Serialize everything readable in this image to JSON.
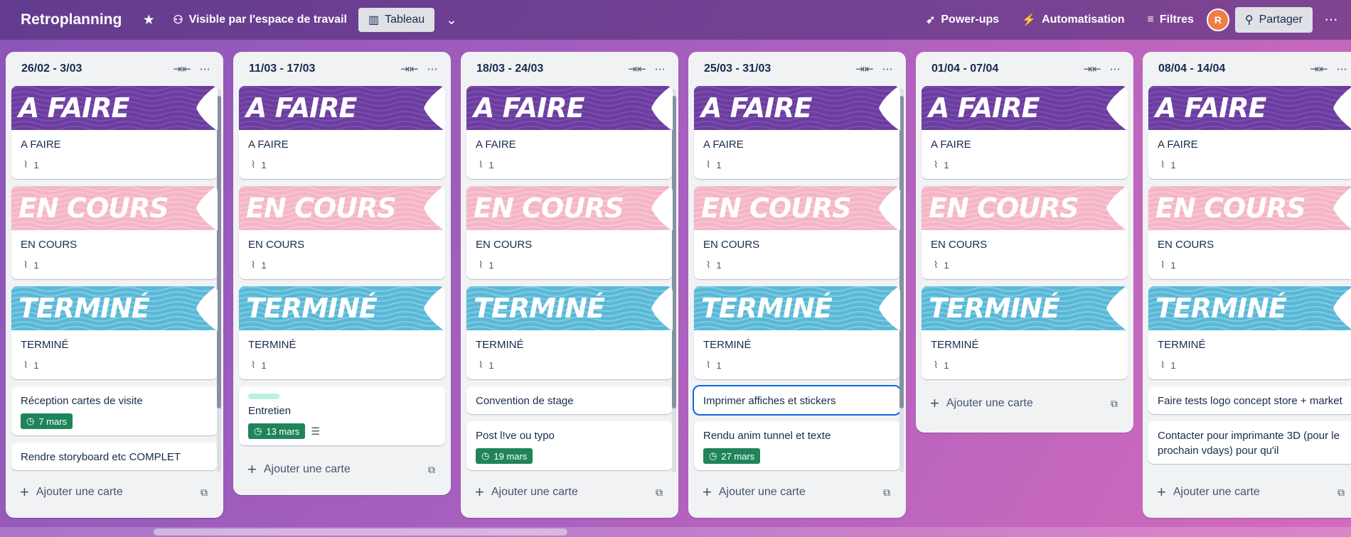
{
  "header": {
    "board_title": "Retroplanning",
    "visibility": "Visible par l'espace de travail",
    "view_label": "Tableau",
    "power_ups": "Power-ups",
    "automation": "Automatisation",
    "filters": "Filtres",
    "share": "Partager",
    "avatar_initials": "R"
  },
  "covers": {
    "todo": "A FAIRE",
    "doing": "EN COURS",
    "done": "TERMINÉ"
  },
  "colors": {
    "todo": "#6b3d9e",
    "doing": "#f4b6c6",
    "done": "#5ab8d6",
    "date_badge": "#1f845a"
  },
  "add_card_label": "Ajouter une carte",
  "lists": [
    {
      "title": "26/02 - 3/03",
      "status_cards": [
        {
          "title": "A FAIRE",
          "attachments": "1"
        },
        {
          "title": "EN COURS",
          "attachments": "1"
        },
        {
          "title": "TERMINÉ",
          "attachments": "1"
        }
      ],
      "extra_cards": [
        {
          "title": "Réception cartes de visite",
          "date": "7 mars"
        },
        {
          "title": "Rendre storyboard etc COMPLET"
        }
      ]
    },
    {
      "title": "11/03 - 17/03",
      "status_cards": [
        {
          "title": "A FAIRE",
          "attachments": "1"
        },
        {
          "title": "EN COURS",
          "attachments": "1"
        },
        {
          "title": "TERMINÉ",
          "attachments": "1"
        }
      ],
      "extra_cards": [
        {
          "title": "Entretien",
          "date": "13 mars",
          "label": true,
          "description": true
        }
      ]
    },
    {
      "title": "18/03 - 24/03",
      "status_cards": [
        {
          "title": "A FAIRE",
          "attachments": "1"
        },
        {
          "title": "EN COURS",
          "attachments": "1"
        },
        {
          "title": "TERMINÉ",
          "attachments": "1"
        }
      ],
      "extra_cards": [
        {
          "title": "Convention de stage"
        },
        {
          "title": "Post l!ve ou typo",
          "date": "19 mars"
        }
      ]
    },
    {
      "title": "25/03 - 31/03",
      "status_cards": [
        {
          "title": "A FAIRE",
          "attachments": "1"
        },
        {
          "title": "EN COURS",
          "attachments": "1"
        },
        {
          "title": "TERMINÉ",
          "attachments": "1"
        }
      ],
      "extra_cards": [
        {
          "title": "Imprimer affiches et stickers",
          "selected": true
        },
        {
          "title": "Rendu anim tunnel et texte",
          "date": "27 mars"
        }
      ]
    },
    {
      "title": "01/04 - 07/04",
      "status_cards": [
        {
          "title": "A FAIRE",
          "attachments": "1"
        },
        {
          "title": "EN COURS",
          "attachments": "1"
        },
        {
          "title": "TERMINÉ",
          "attachments": "1"
        }
      ],
      "extra_cards": []
    },
    {
      "title": "08/04 - 14/04",
      "status_cards": [
        {
          "title": "A FAIRE",
          "attachments": "1"
        },
        {
          "title": "EN COURS",
          "attachments": "1"
        },
        {
          "title": "TERMINÉ",
          "attachments": "1"
        }
      ],
      "extra_cards": [
        {
          "title": "Faire tests logo concept store + market"
        },
        {
          "title": "Contacter pour imprimante 3D (pour le prochain vdays) pour qu'il"
        }
      ]
    }
  ]
}
